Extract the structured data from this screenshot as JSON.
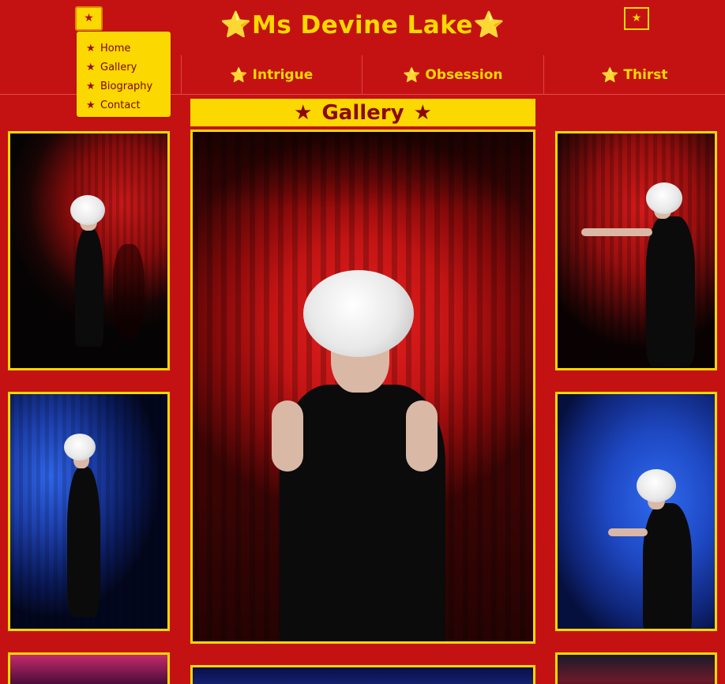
{
  "header": {
    "title": "Ms Devine Lake",
    "star": "⭐",
    "menu_icon": "star-icon",
    "menu_glyph": "★"
  },
  "dropdown": {
    "items": [
      {
        "label": "Home",
        "icon": "star-icon"
      },
      {
        "label": "Gallery",
        "icon": "star-icon"
      },
      {
        "label": "Biography",
        "icon": "star-icon"
      },
      {
        "label": "Contact",
        "icon": "star-icon"
      }
    ]
  },
  "nav": {
    "items": [
      {
        "label": "",
        "icon": "star-icon"
      },
      {
        "label": "Intrigue",
        "icon": "star-icon"
      },
      {
        "label": "Obsession",
        "icon": "star-icon"
      },
      {
        "label": "Thirst",
        "icon": "star-icon"
      }
    ]
  },
  "gallery": {
    "heading": "Gallery"
  },
  "colors": {
    "background": "#c41212",
    "accent": "#fad800",
    "dark_red": "#8c0808"
  }
}
